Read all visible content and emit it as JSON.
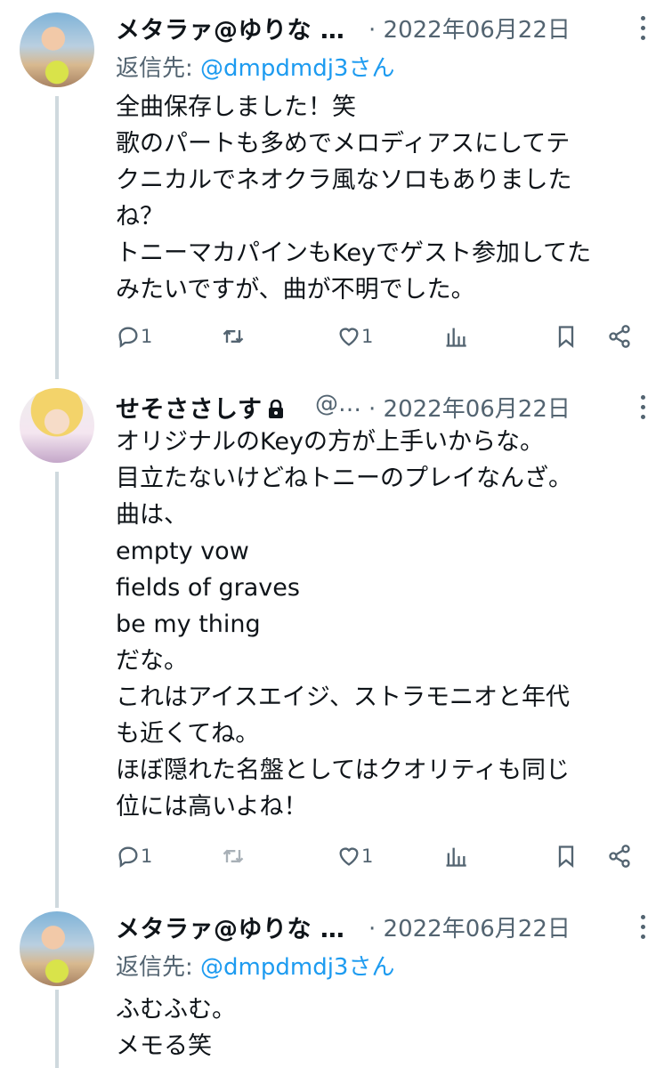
{
  "tweets": [
    {
      "name": "メタラァ@ゆりな …",
      "handle": "",
      "date": "· 2022年06月22日",
      "reply_prefix": "返信先: ",
      "reply_handle": "@dmpdmdj3さん",
      "body": "全曲保存しました！笑\n歌のパートも多めでメロディアスにしてテ\nクニカルでネオクラ風なソロもありました\nね？\nトニーマカパインもKeyでゲスト参加してた\nみたいですが、曲が不明でした。",
      "replies": "1",
      "retweets": "",
      "likes": "1"
    },
    {
      "name": "せそささしす",
      "handle": "@…",
      "date": "· 2022年06月22日",
      "body": "オリジナルのKeyの方が上手いからな。\n目立たないけどねトニーのプレイなんざ。\n曲は、\nempty vow\nfields of graves\nbe my thing\nだな。\nこれはアイスエイジ、ストラモニオと年代\nも近くてね。\nほぼ隠れた名盤としてはクオリティも同じ\n位には高いよね！",
      "replies": "1",
      "retweets": "",
      "likes": "1"
    },
    {
      "name": "メタラァ@ゆりな …",
      "date": "· 2022年06月22日",
      "reply_prefix": "返信先: ",
      "reply_handle": "@dmpdmdj3さん",
      "body": "ふむふむ。\nメモる笑"
    }
  ],
  "icons": {
    "reply": "reply-icon",
    "retweet": "retweet-icon",
    "like": "heart-icon",
    "views": "views-icon",
    "bookmark": "bookmark-icon",
    "share": "share-icon",
    "lock": "lock-icon",
    "more": "more-icon"
  },
  "colors": {
    "accent": "#1d9bf0",
    "muted": "#536471",
    "line": "#cfd9de"
  }
}
